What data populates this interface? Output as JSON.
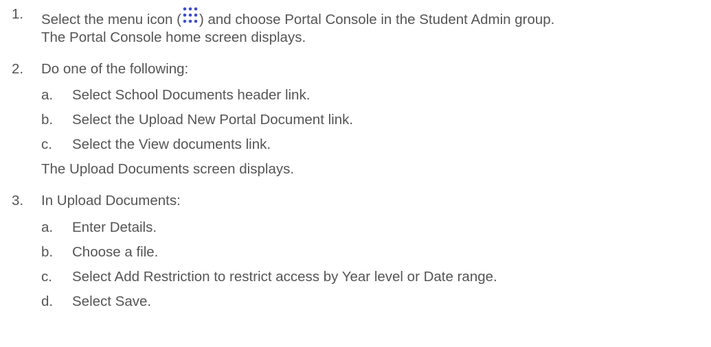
{
  "steps": [
    {
      "number": "1.",
      "text_before_icon": "Select the menu icon (",
      "icon": "grid-dots-icon",
      "text_after_icon": ") and choose Portal Console in the Student Admin group.",
      "result": "The Portal Console home screen displays."
    },
    {
      "number": "2.",
      "text": "Do one of the following:",
      "substeps": [
        {
          "letter": "a.",
          "text": "Select School Documents header link."
        },
        {
          "letter": "b.",
          "text": "Select the Upload New Portal Document link."
        },
        {
          "letter": "c.",
          "text": "Select the View documents link."
        }
      ],
      "result": "The Upload Documents screen displays."
    },
    {
      "number": "3.",
      "text": "In Upload Documents:",
      "substeps": [
        {
          "letter": "a.",
          "text": "Enter Details."
        },
        {
          "letter": "b.",
          "text": "Choose a file."
        },
        {
          "letter": "c.",
          "text": "Select Add Restriction to restrict access by Year level or Date range."
        },
        {
          "letter": "d.",
          "text": "Select Save."
        }
      ]
    }
  ],
  "colors": {
    "text": "#555555",
    "icon": "#3d4ec9"
  }
}
